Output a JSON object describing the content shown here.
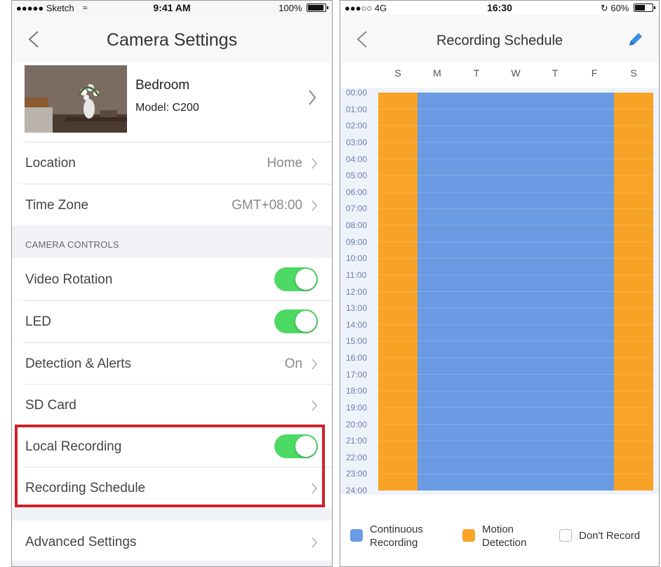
{
  "left": {
    "status": {
      "carrier": "●●●●● Sketch",
      "time": "9:41 AM",
      "battery": "100%"
    },
    "nav": {
      "title": "Camera Settings"
    },
    "camera": {
      "name": "Bedroom",
      "model": "Model: C200"
    },
    "rows": [
      {
        "label": "Location",
        "value": "Home"
      },
      {
        "label": "Time Zone",
        "value": "GMT+08:00"
      }
    ],
    "section": "CAMERA CONTROLS",
    "controls": [
      {
        "label": "Video Rotation",
        "on": true
      },
      {
        "label": "LED",
        "on": true
      },
      {
        "label": "Detection & Alerts",
        "value": "On"
      },
      {
        "label": "SD Card"
      },
      {
        "label": "Local Recording",
        "on": true
      },
      {
        "label": "Recording Schedule"
      },
      {
        "label": "Advanced Settings"
      }
    ]
  },
  "right": {
    "status": {
      "carrier": "●●●○○ 4G",
      "time": "16:30",
      "battery": "60%"
    },
    "nav": {
      "title": "Recording Schedule"
    },
    "days": [
      "S",
      "M",
      "T",
      "W",
      "T",
      "F",
      "S"
    ],
    "hours": [
      "00:00",
      "01:00",
      "02:00",
      "03:00",
      "04:00",
      "05:00",
      "06:00",
      "07:00",
      "08:00",
      "09:00",
      "10:00",
      "11:00",
      "12:00",
      "13:00",
      "14:00",
      "15:00",
      "16:00",
      "17:00",
      "18:00",
      "19:00",
      "20:00",
      "21:00",
      "22:00",
      "23:00",
      "24:00"
    ],
    "schedule": [
      "motion",
      "continuous",
      "continuous",
      "continuous",
      "continuous",
      "continuous",
      "motion"
    ],
    "legend": {
      "continuous": "Continuous Recording",
      "continuous_l1": "Continuous",
      "continuous_l2": "Recording",
      "motion_l1": "Motion",
      "motion_l2": "Detection",
      "none": "Don't Record"
    },
    "colors": {
      "continuous": "#6a9be3",
      "motion": "#f7a326",
      "toggle_on": "#4cd964",
      "highlight": "#d0202a"
    }
  }
}
